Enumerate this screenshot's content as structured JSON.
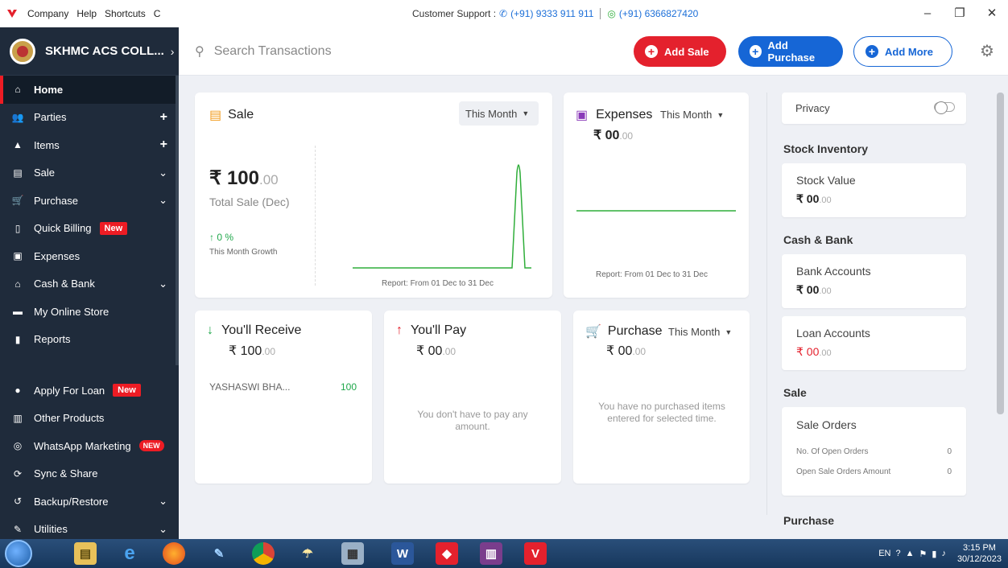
{
  "titlebar": {
    "menu": [
      "Company",
      "Help",
      "Shortcuts"
    ],
    "refresh_icon": "C",
    "support_label": "Customer Support :",
    "phone1": "(+91) 9333 911 911",
    "phone2": "(+91) 6366827420",
    "controls": [
      "–",
      "❐",
      "✕"
    ]
  },
  "company": {
    "name": "SKHMC ACS COLL..."
  },
  "sidebar": {
    "items": [
      {
        "label": "Home"
      },
      {
        "label": "Parties"
      },
      {
        "label": "Items"
      },
      {
        "label": "Sale"
      },
      {
        "label": "Purchase"
      },
      {
        "label": "Quick Billing",
        "badge": "New"
      },
      {
        "label": "Expenses"
      },
      {
        "label": "Cash & Bank"
      },
      {
        "label": "My Online Store"
      },
      {
        "label": "Reports"
      }
    ],
    "items2": [
      {
        "label": "Apply For Loan",
        "badge": "New"
      },
      {
        "label": "Other Products"
      },
      {
        "label": "WhatsApp Marketing",
        "badge": "NEW"
      },
      {
        "label": "Sync & Share"
      },
      {
        "label": "Backup/Restore"
      },
      {
        "label": "Utilities"
      }
    ]
  },
  "topbar": {
    "search_placeholder": "Search Transactions",
    "add_sale": "Add Sale",
    "add_purchase": "Add Purchase",
    "add_more": "Add More"
  },
  "sale": {
    "title": "Sale",
    "period": "This Month",
    "amount": "₹ 100",
    "amount_dec": ".00",
    "caption": "Total Sale (Dec)",
    "growth": "↑ 0 %",
    "growth_caption": "This Month Growth",
    "report": "Report: From 01 Dec to 31 Dec"
  },
  "expenses": {
    "title": "Expenses",
    "period": "This Month",
    "amount": "₹ 00",
    "amount_dec": ".00",
    "report": "Report: From 01 Dec to 31 Dec"
  },
  "receive": {
    "title": "You'll Receive",
    "amount": "₹ 100",
    "amount_dec": ".00",
    "party": "YASHASWI BHA...",
    "party_amount": "100"
  },
  "pay": {
    "title": "You'll Pay",
    "amount": "₹ 00",
    "amount_dec": ".00",
    "message": "You don't have to pay any amount."
  },
  "purchase": {
    "title": "Purchase",
    "period": "This Month",
    "amount": "₹ 00",
    "amount_dec": ".00",
    "message": "You have no purchased items entered for selected time."
  },
  "right": {
    "privacy": "Privacy",
    "stock_inventory": "Stock Inventory",
    "stock_value_label": "Stock Value",
    "stock_value": "₹ 00",
    "stock_value_dec": ".00",
    "cash_bank": "Cash & Bank",
    "bank_accounts_label": "Bank Accounts",
    "bank_accounts": "₹ 00",
    "bank_accounts_dec": ".00",
    "loan_accounts_label": "Loan Accounts",
    "loan_accounts": "₹ 00",
    "loan_accounts_dec": ".00",
    "sale_head": "Sale",
    "sale_orders": "Sale Orders",
    "open_orders_label": "No. Of Open Orders",
    "open_orders": "0",
    "open_amount_label": "Open Sale Orders Amount",
    "open_amount": "0",
    "purchase_head": "Purchase"
  },
  "taskbar": {
    "lang": "EN",
    "time": "3:15 PM",
    "date": "30/12/2023"
  },
  "colors": {
    "brand_red": "#e4212d",
    "brand_blue": "#1666d6",
    "sidebar_bg": "#1f2b3b",
    "chart_green": "#2fae3a"
  }
}
